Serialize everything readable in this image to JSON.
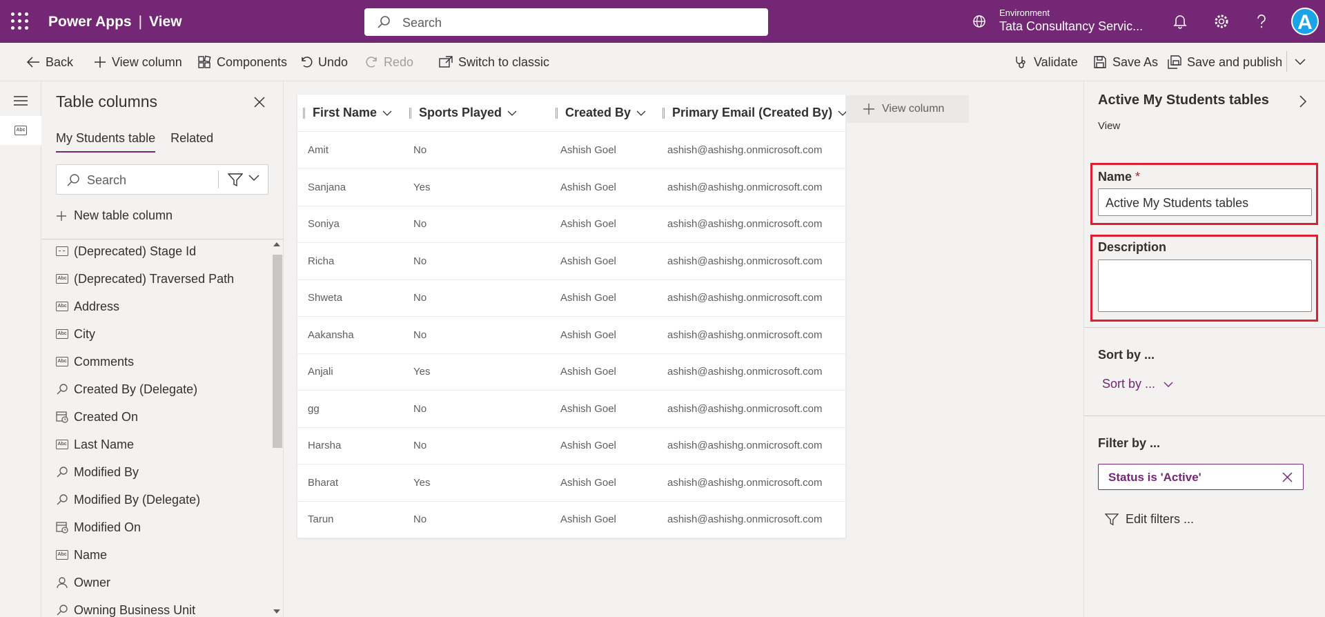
{
  "header": {
    "app_name": "Power Apps",
    "page_name": "View",
    "separator": "|",
    "search_placeholder": "Search",
    "environment_label": "Environment",
    "environment_value": "Tata Consultancy Servic...",
    "avatar_letter": "A",
    "brand_color": "#742774"
  },
  "toolbar": {
    "back": "Back",
    "view_column": "View column",
    "components": "Components",
    "undo": "Undo",
    "redo": "Redo",
    "switch_classic": "Switch to classic",
    "validate": "Validate",
    "save_as": "Save As",
    "save_publish": "Save and publish"
  },
  "left_panel": {
    "title": "Table columns",
    "tabs": [
      {
        "label": "My Students table",
        "active": true
      },
      {
        "label": "Related",
        "active": false
      }
    ],
    "search_placeholder": "Search",
    "new_column": "New table column",
    "columns": [
      {
        "label": "(Deprecated) Stage Id",
        "icon": "stage-icon"
      },
      {
        "label": "(Deprecated) Traversed Path",
        "icon": "text-icon"
      },
      {
        "label": "Address",
        "icon": "text-icon"
      },
      {
        "label": "City",
        "icon": "text-icon"
      },
      {
        "label": "Comments",
        "icon": "text-icon"
      },
      {
        "label": "Created By (Delegate)",
        "icon": "lookup-icon"
      },
      {
        "label": "Created On",
        "icon": "calendar-icon"
      },
      {
        "label": "Last Name",
        "icon": "text-icon"
      },
      {
        "label": "Modified By",
        "icon": "lookup-icon"
      },
      {
        "label": "Modified By (Delegate)",
        "icon": "lookup-icon"
      },
      {
        "label": "Modified On",
        "icon": "calendar-icon"
      },
      {
        "label": "Name",
        "icon": "text-icon"
      },
      {
        "label": "Owner",
        "icon": "person-icon"
      },
      {
        "label": "Owning Business Unit",
        "icon": "lookup-icon"
      }
    ]
  },
  "grid": {
    "columns": [
      "First Name",
      "Sports Played",
      "Created By",
      "Primary Email (Created By)"
    ],
    "add_column": "View column",
    "rows": [
      [
        "Amit",
        "No",
        "Ashish Goel",
        "ashish@ashishg.onmicrosoft.com"
      ],
      [
        "Sanjana",
        "Yes",
        "Ashish Goel",
        "ashish@ashishg.onmicrosoft.com"
      ],
      [
        "Soniya",
        "No",
        "Ashish Goel",
        "ashish@ashishg.onmicrosoft.com"
      ],
      [
        "Richa",
        "No",
        "Ashish Goel",
        "ashish@ashishg.onmicrosoft.com"
      ],
      [
        "Shweta",
        "No",
        "Ashish Goel",
        "ashish@ashishg.onmicrosoft.com"
      ],
      [
        "Aakansha",
        "No",
        "Ashish Goel",
        "ashish@ashishg.onmicrosoft.com"
      ],
      [
        "Anjali",
        "Yes",
        "Ashish Goel",
        "ashish@ashishg.onmicrosoft.com"
      ],
      [
        "gg",
        "No",
        "Ashish Goel",
        "ashish@ashishg.onmicrosoft.com"
      ],
      [
        "Harsha",
        "No",
        "Ashish Goel",
        "ashish@ashishg.onmicrosoft.com"
      ],
      [
        "Bharat",
        "Yes",
        "Ashish Goel",
        "ashish@ashishg.onmicrosoft.com"
      ],
      [
        "Tarun",
        "No",
        "Ashish Goel",
        "ashish@ashishg.onmicrosoft.com"
      ]
    ]
  },
  "right_panel": {
    "title": "Active My Students tables",
    "subtitle": "View",
    "name_label": "Name",
    "required_mark": "*",
    "name_value": "Active My Students tables",
    "description_label": "Description",
    "description_value": "",
    "sort_heading": "Sort by ...",
    "sort_dropdown": "Sort by ...",
    "filter_heading": "Filter by ...",
    "filter_chip": "Status is 'Active'",
    "edit_filters": "Edit filters ...",
    "highlight_color": "#dd2030"
  }
}
